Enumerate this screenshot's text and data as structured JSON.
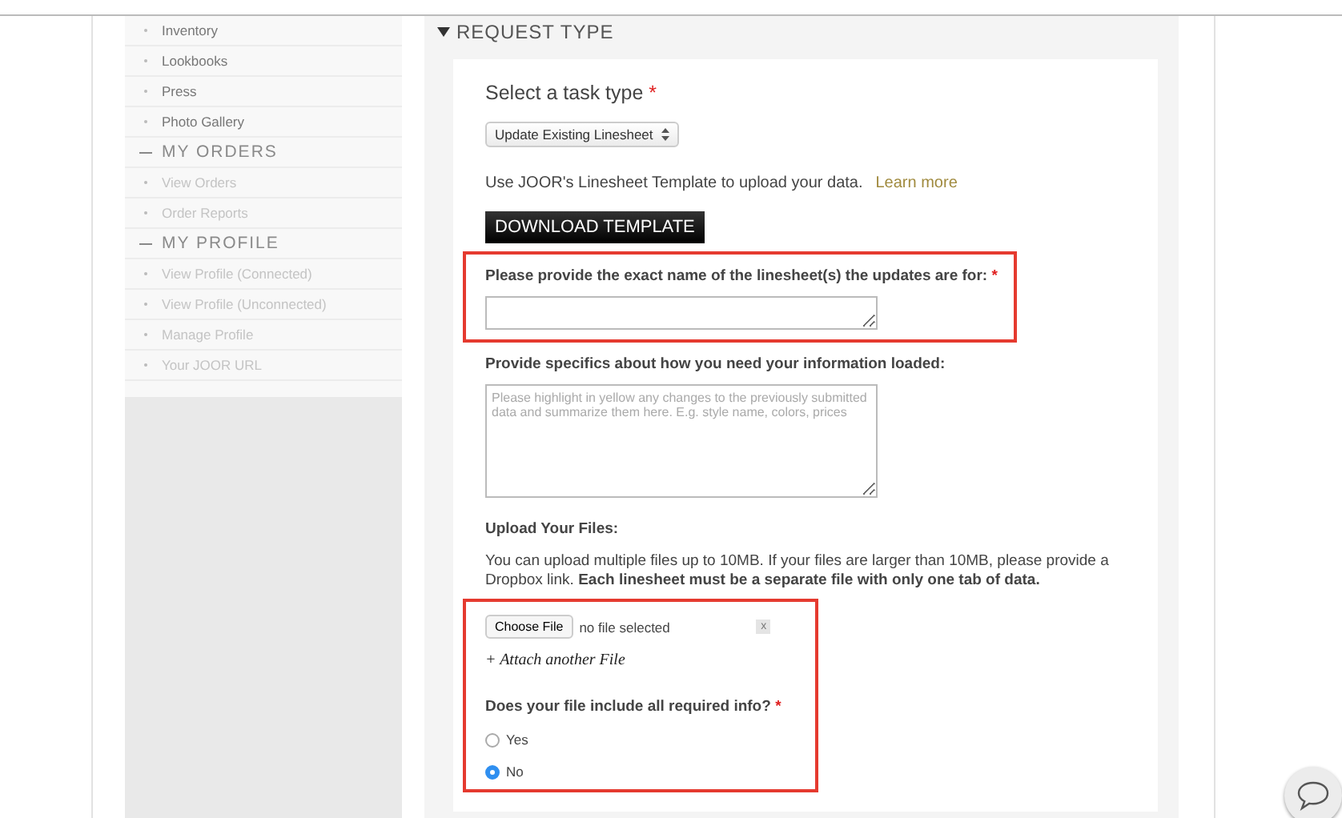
{
  "sidebar": {
    "items": [
      {
        "kind": "link",
        "label": "Inventory",
        "dimmed": false
      },
      {
        "kind": "link",
        "label": "Lookbooks",
        "dimmed": false
      },
      {
        "kind": "link",
        "label": "Press",
        "dimmed": false
      },
      {
        "kind": "link",
        "label": "Photo Gallery",
        "dimmed": false
      },
      {
        "kind": "section",
        "label": "MY ORDERS",
        "dimmed": false
      },
      {
        "kind": "link",
        "label": "View Orders",
        "dimmed": true
      },
      {
        "kind": "link",
        "label": "Order Reports",
        "dimmed": true
      },
      {
        "kind": "section",
        "label": "MY PROFILE",
        "dimmed": false
      },
      {
        "kind": "link",
        "label": "View Profile (Connected)",
        "dimmed": true
      },
      {
        "kind": "link",
        "label": "View Profile (Unconnected)",
        "dimmed": true
      },
      {
        "kind": "link",
        "label": "Manage Profile",
        "dimmed": true
      },
      {
        "kind": "link",
        "label": "Your JOOR URL",
        "dimmed": true
      }
    ]
  },
  "panel": {
    "title": "REQUEST TYPE",
    "expanded": true,
    "task": {
      "label": "Select a task type",
      "required_mark": "*",
      "value": "Update Existing Linesheet"
    },
    "template": {
      "text": "Use JOOR's Linesheet Template to upload your data.",
      "link": "Learn more",
      "button": "DOWNLOAD TEMPLATE"
    },
    "linesheet_name": {
      "label": "Please provide the exact name of the linesheet(s) the updates are for:",
      "required_mark": "*",
      "highlighted": true
    },
    "specifics": {
      "label": "Provide specifics about how you need your information loaded:",
      "placeholder": "Please highlight in yellow any changes to the previously submitted data and summarize them here. E.g. style name, colors, prices"
    },
    "upload": {
      "title": "Upload Your Files:",
      "note": "You can upload multiple files up to 10MB. If your files are larger than 10MB, please provide a Dropbox link. **Each linesheet must be a separate file with only one tab of data.**",
      "highlighted": true,
      "choose_button": "Choose File",
      "file_status": "no file selected",
      "remove": "x",
      "attach": "+ Attach another File",
      "question": {
        "label": "Does your file include all required info?",
        "required_mark": "*",
        "options": [
          {
            "label": "Yes",
            "selected": false
          },
          {
            "label": "No",
            "selected": true
          }
        ]
      }
    }
  }
}
